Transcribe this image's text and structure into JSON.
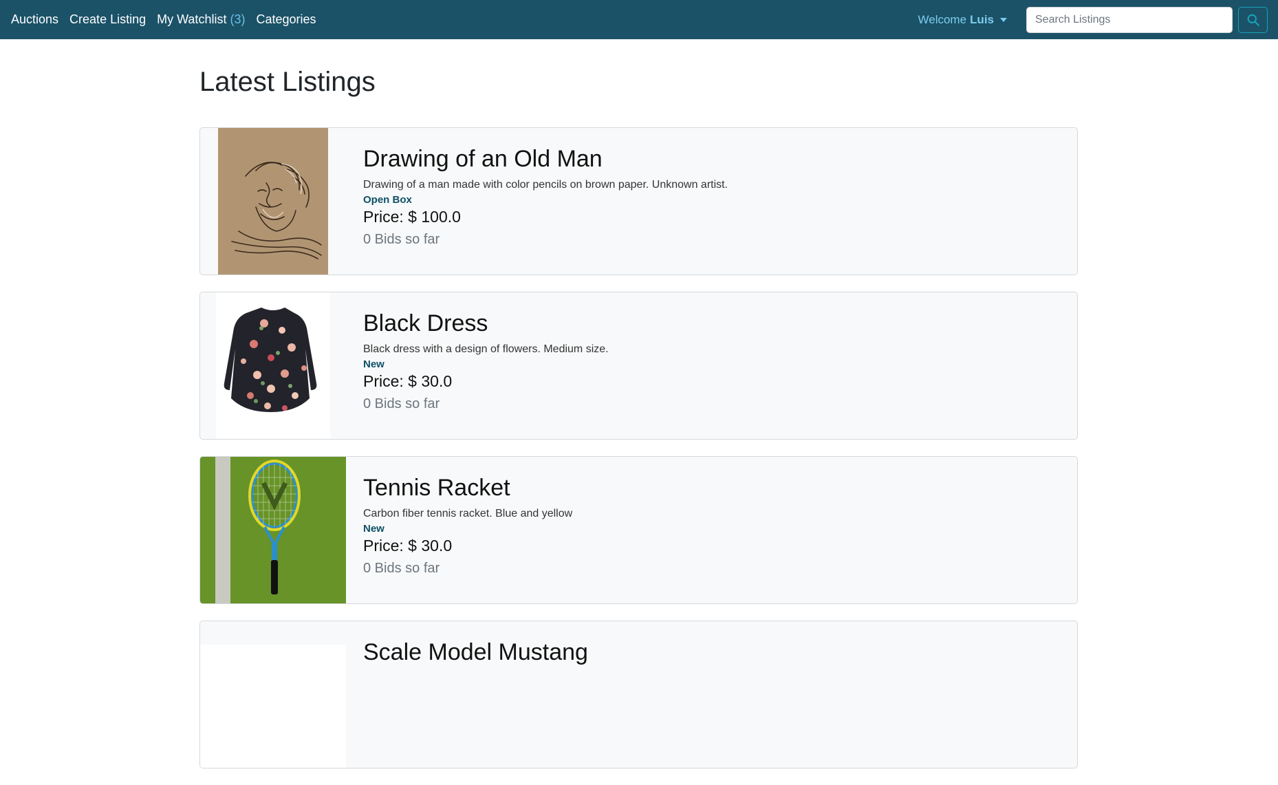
{
  "nav": {
    "links": [
      {
        "label": "Auctions"
      },
      {
        "label": "Create Listing"
      },
      {
        "label": "My Watchlist",
        "count": "(3)"
      },
      {
        "label": "Categories"
      }
    ],
    "welcome_prefix": "Welcome",
    "username": "Luis",
    "search_placeholder": "Search Listings"
  },
  "page": {
    "title": "Latest Listings"
  },
  "listings": [
    {
      "title": "Drawing of an Old Man",
      "description": "Drawing of a man made with color pencils on brown paper. Unknown artist.",
      "condition": "Open Box",
      "price": "Price: $ 100.0",
      "bids": "0 Bids so far"
    },
    {
      "title": "Black Dress",
      "description": "Black dress with a design of flowers. Medium size.",
      "condition": "New",
      "price": "Price: $ 30.0",
      "bids": "0 Bids so far"
    },
    {
      "title": "Tennis Racket",
      "description": "Carbon fiber tennis racket. Blue and yellow",
      "condition": "New",
      "price": "Price: $ 30.0",
      "bids": "0 Bids so far"
    },
    {
      "title": "Scale Model Mustang"
    }
  ],
  "colors": {
    "navbar": "#1b5268",
    "accent": "#17a2b8",
    "condition": "#0e4f66"
  }
}
